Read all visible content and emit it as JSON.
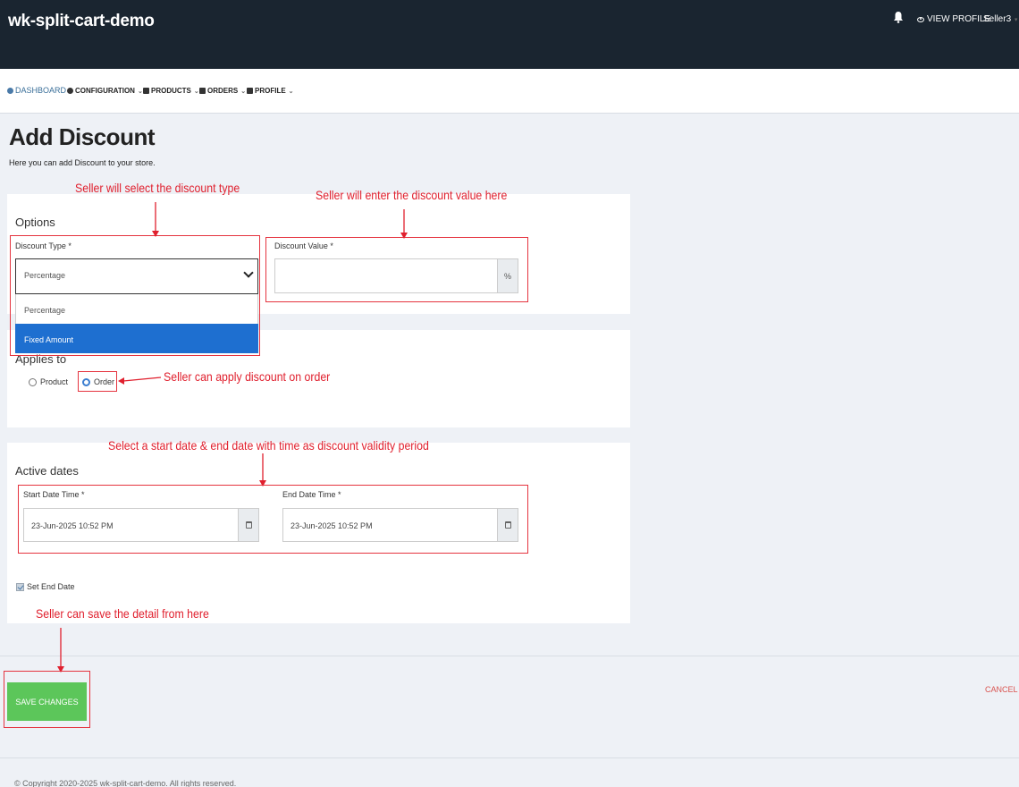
{
  "header": {
    "brand": "wk-split-cart-demo",
    "view_profile": "VIEW PROFILE",
    "user": "Seller3"
  },
  "nav": {
    "items": [
      {
        "label": "DASHBOARD"
      },
      {
        "label": "CONFIGURATION"
      },
      {
        "label": "PRODUCTS"
      },
      {
        "label": "ORDERS"
      },
      {
        "label": "PROFILE"
      }
    ]
  },
  "page": {
    "title": "Add Discount",
    "subtitle": "Here you can add Discount to your store."
  },
  "options": {
    "section_title": "Options",
    "discount_type_label": "Discount Type *",
    "discount_type_value": "Percentage",
    "dropdown_options": [
      "Percentage",
      "Fixed Amount"
    ],
    "discount_value_label": "Discount Value *",
    "discount_value": "",
    "discount_value_unit": "%"
  },
  "applies": {
    "section_title": "Applies to",
    "options": [
      "Product",
      "Order"
    ]
  },
  "dates": {
    "section_title": "Active dates",
    "start_label": "Start Date Time *",
    "start_value": "23-Jun-2025 10:52 PM",
    "end_label": "End Date Time *",
    "end_value": "23-Jun-2025 10:52 PM",
    "set_end_date_label": "Set End Date"
  },
  "actions": {
    "save": "SAVE CHANGES",
    "cancel": "CANCEL"
  },
  "footer": {
    "text": "© Copyright 2020-2025 wk-split-cart-demo. All rights reserved."
  },
  "annotations": {
    "discount_type": "Seller will select the discount type",
    "discount_value": "Seller will enter the discount value here",
    "order": "Seller can apply discount on order",
    "dates": "Select a start date & end date with time as discount validity period",
    "save": "Seller can save the detail from here"
  },
  "colors": {
    "topbar": "#1a2530",
    "annotation": "#e0202e",
    "save_button": "#5cc65a",
    "dropdown_highlight": "#1e6fd0",
    "cancel": "#d9534f"
  }
}
